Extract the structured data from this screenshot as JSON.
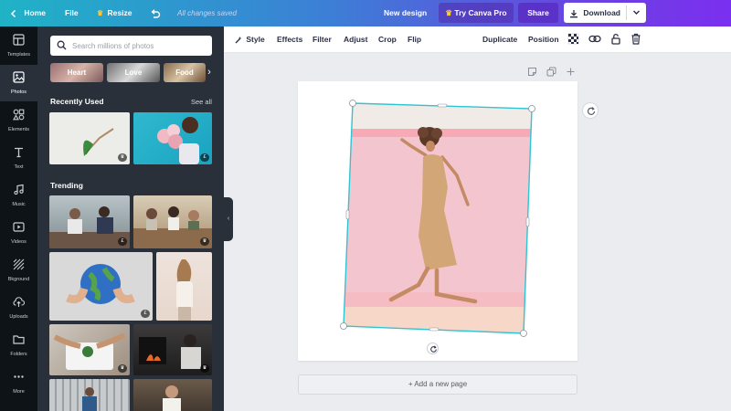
{
  "topbar": {
    "home": "Home",
    "file": "File",
    "resize": "Resize",
    "save_status": "All changes saved",
    "new_design": "New design",
    "try_pro": "Try Canva Pro",
    "share": "Share",
    "download": "Download"
  },
  "leftnav": {
    "items": [
      {
        "label": "Templates",
        "icon": "templates-icon"
      },
      {
        "label": "Photos",
        "icon": "photos-icon",
        "active": true
      },
      {
        "label": "Elements",
        "icon": "elements-icon"
      },
      {
        "label": "Text",
        "icon": "text-icon"
      },
      {
        "label": "Music",
        "icon": "music-icon"
      },
      {
        "label": "Videos",
        "icon": "videos-icon"
      },
      {
        "label": "Bkground",
        "icon": "background-icon"
      },
      {
        "label": "Uploads",
        "icon": "uploads-icon"
      },
      {
        "label": "Folders",
        "icon": "folders-icon"
      },
      {
        "label": "More",
        "icon": "more-icon"
      }
    ]
  },
  "panel": {
    "search_placeholder": "Search millions of photos",
    "chips": [
      "Heart",
      "Love",
      "Food"
    ],
    "recently_used": "Recently Used",
    "see_all": "See all",
    "trending": "Trending",
    "badge_crown": "♛",
    "badge_free": "£"
  },
  "toolbar": {
    "style": "Style",
    "effects": "Effects",
    "filter": "Filter",
    "adjust": "Adjust",
    "crop": "Crop",
    "flip": "Flip",
    "duplicate": "Duplicate",
    "position": "Position"
  },
  "canvas": {
    "add_page": "+ Add a new page"
  },
  "colors": {
    "selection": "#2fc4d2",
    "panel_bg": "#293039",
    "nav_bg": "#0e1318",
    "pro_purple": "#5a32c8"
  }
}
